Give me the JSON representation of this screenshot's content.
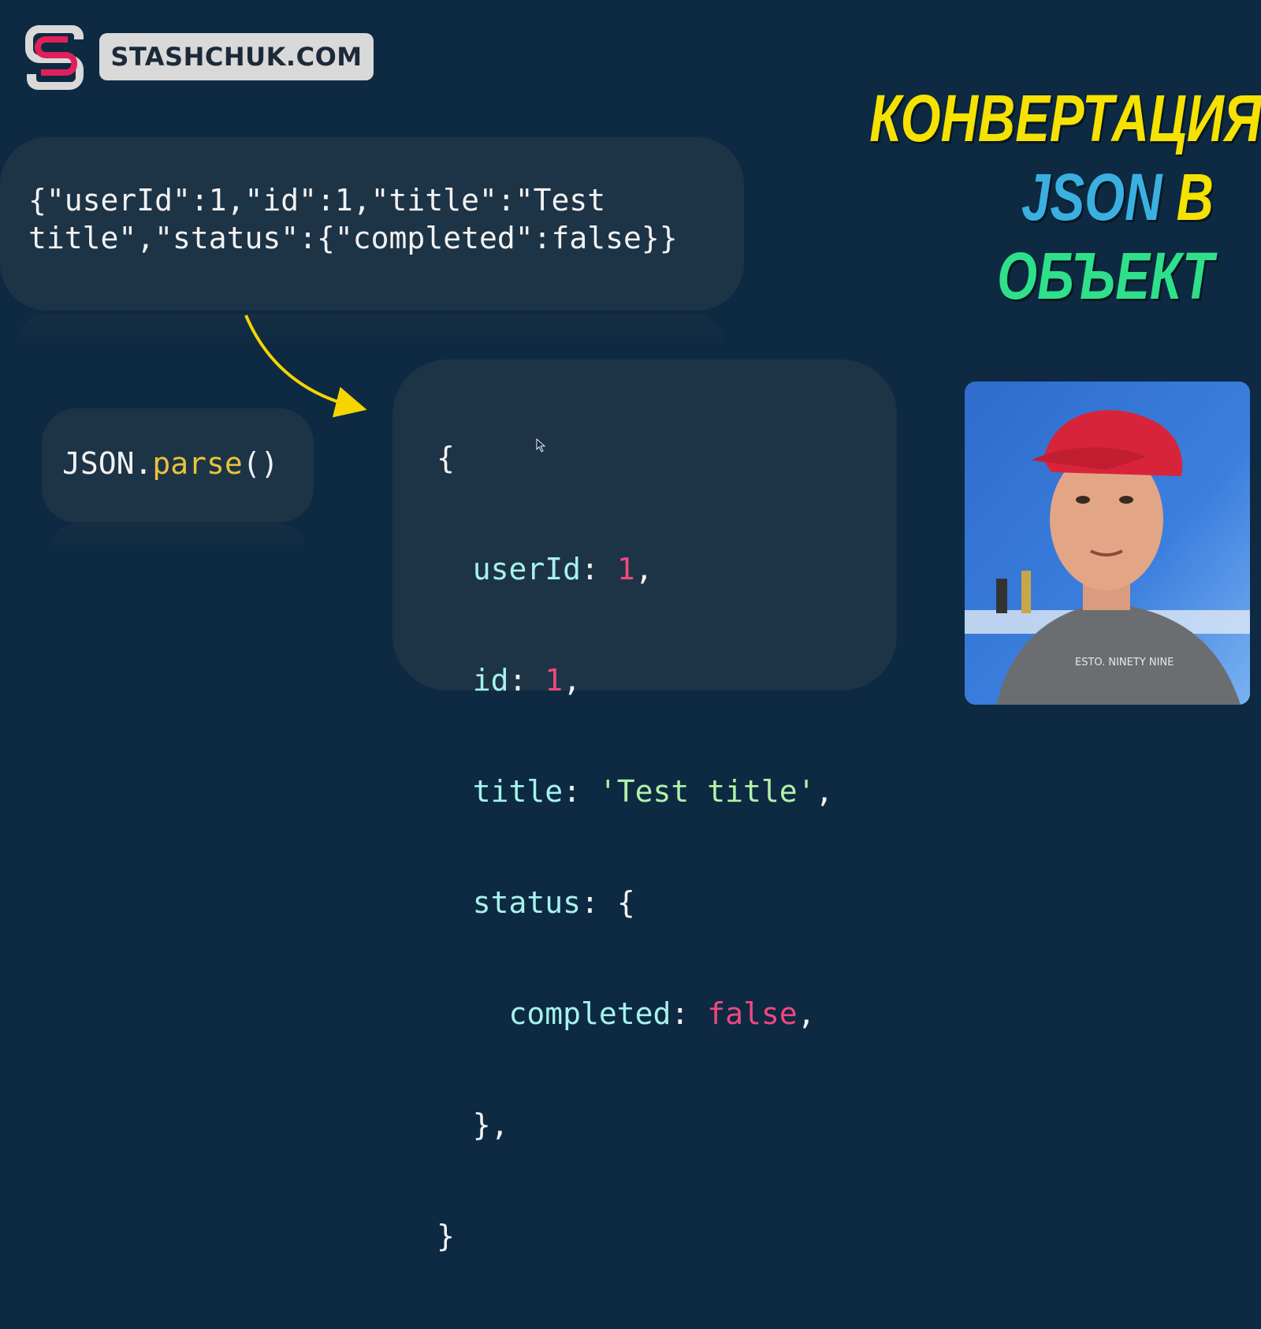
{
  "brand": {
    "site_label": "STASHCHUK.COM",
    "mark_colors": {
      "primary": "#d9d9d9",
      "accent": "#e0205a"
    }
  },
  "headline": {
    "line1": "КОНВЕРТАЦИЯ",
    "json_word": "JSON",
    "v_word": "В",
    "object_word": "ОБЪЕКТ",
    "colors": {
      "yellow": "#f5e200",
      "blue": "#3ab0e0",
      "green": "#2ee08a"
    }
  },
  "json_panel": {
    "line1": "{\"userId\":1,\"id\":1,\"title\":\"Test",
    "line2": "title\",\"status\":{\"completed\":false}}"
  },
  "parse_panel": {
    "obj": "JSON.",
    "method": "parse",
    "parens": "()"
  },
  "object_panel": {
    "open_brace": "{",
    "userId_key": "userId",
    "userId_val": "1",
    "id_key": "id",
    "id_val": "1",
    "title_key": "title",
    "title_val": "'Test title'",
    "status_key": "status",
    "status_open": "{",
    "completed_key": "completed",
    "completed_val": "false",
    "status_close": "},",
    "close_brace": "}"
  },
  "video_overlay": {
    "shirt_text": "ESTO. NINETY NINE"
  },
  "colors": {
    "background": "#0d2a42",
    "panel": "#1d3346",
    "arrow": "#f5d400"
  }
}
